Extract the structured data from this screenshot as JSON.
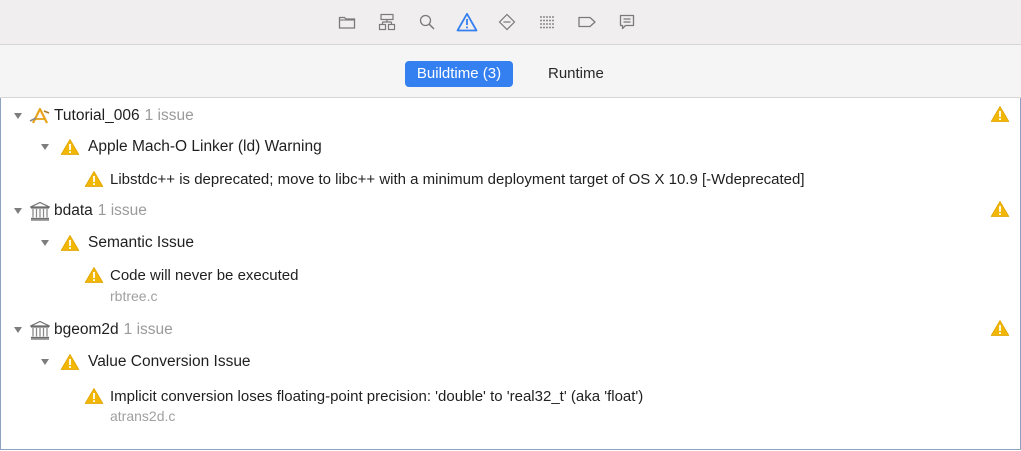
{
  "toolbar": {
    "icons": [
      "folder-icon",
      "hierarchy-icon",
      "search-icon",
      "warning-icon",
      "diamond-icon",
      "list-icon",
      "tag-icon",
      "message-icon"
    ],
    "active_icon": "warning-icon"
  },
  "tabs": {
    "buildtime": "Buildtime (3)",
    "runtime": "Runtime",
    "active": "buildtime"
  },
  "issues": {
    "group1": {
      "name": "Tutorial_006",
      "count": "1 issue",
      "category": "Apple Mach-O Linker (ld) Warning",
      "message": "Libstdc++ is deprecated; move to libc++ with a minimum deployment target of OS X 10.9 [-Wdeprecated]"
    },
    "group2": {
      "name": "bdata",
      "count": "1 issue",
      "category": "Semantic Issue",
      "message": "Code will never be executed",
      "file": "rbtree.c"
    },
    "group3": {
      "name": "bgeom2d",
      "count": "1 issue",
      "category": "Value Conversion Issue",
      "message": "Implicit conversion loses floating-point precision: 'double' to 'real32_t' (aka 'float')",
      "file": "atrans2d.c"
    }
  },
  "colors": {
    "accent": "#3580f0",
    "warning": "#f2b705",
    "toolbar_bg": "#f0eeef"
  }
}
